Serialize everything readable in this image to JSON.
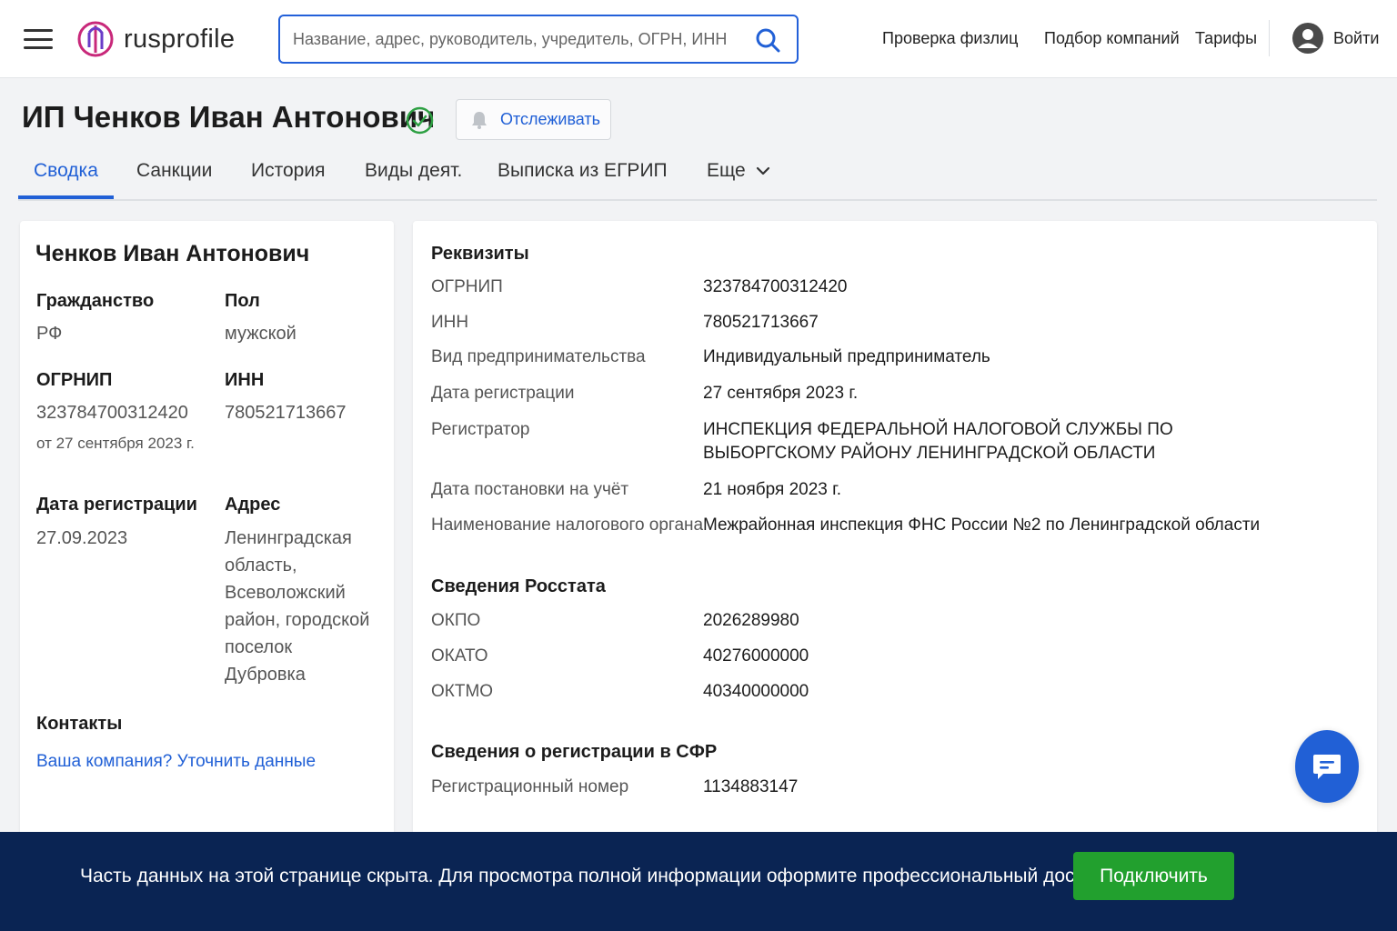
{
  "header": {
    "logo_text": "rusprofile",
    "search_placeholder": "Название, адрес, руководитель, учредитель, ОГРН, ИНН",
    "nav": [
      "Проверка физлиц",
      "Подбор компаний",
      "Тарифы"
    ],
    "login_label": "Войти"
  },
  "title": {
    "name": "ИП Ченков Иван Антонович",
    "track_label": "Отслеживать"
  },
  "tabs": [
    "Сводка",
    "Санкции",
    "История",
    "Виды деят.",
    "Выписка из ЕГРИП",
    "Еще"
  ],
  "left_card": {
    "name": "Ченков Иван Антонович",
    "citizenship_label": "Гражданство",
    "citizenship_value": "РФ",
    "gender_label": "Пол",
    "gender_value": "мужской",
    "ogrnip_label": "ОГРНИП",
    "ogrnip_value": "323784700312420",
    "ogrnip_date": "от 27 сентября 2023 г.",
    "inn_label": "ИНН",
    "inn_value": "780521713667",
    "regdate_label": "Дата регистрации",
    "regdate_value": "27.09.2023",
    "address_label": "Адрес",
    "address_value": "Ленинградская область, Всеволожский район, городской поселок Дубровка",
    "contacts_label": "Контакты",
    "contacts_link": "Ваша компания? Уточнить данные"
  },
  "right_card": {
    "requisites_title": "Реквизиты",
    "requisites": [
      {
        "label": "ОГРНИП",
        "value": "323784700312420"
      },
      {
        "label": "ИНН",
        "value": "780521713667"
      },
      {
        "label": "Вид предпринимательства",
        "value": "Индивидуальный предприниматель"
      },
      {
        "label": "Дата регистрации",
        "value": "27 сентября 2023 г."
      },
      {
        "label": "Регистратор",
        "value": "ИНСПЕКЦИЯ ФЕДЕРАЛЬНОЙ НАЛОГОВОЙ СЛУЖБЫ ПО ВЫБОРГСКОМУ РАЙОНУ ЛЕНИНГРАДСКОЙ ОБЛАСТИ"
      },
      {
        "label": "Дата постановки на учёт",
        "value": "21 ноября 2023 г."
      },
      {
        "label": "Наименование налогового органа",
        "value": "Межрайонная инспекция ФНС России №2 по Ленинградской области"
      }
    ],
    "rosstat_title": "Сведения Росстата",
    "rosstat": [
      {
        "label": "ОКПО",
        "value": "2026289980"
      },
      {
        "label": "ОКАТО",
        "value": "40276000000"
      },
      {
        "label": "ОКТМО",
        "value": "40340000000"
      }
    ],
    "sfr_title": "Сведения о регистрации в СФР",
    "sfr": [
      {
        "label": "Регистрационный номер",
        "value": "1134883147"
      }
    ]
  },
  "banner": {
    "text": "Часть данных на этой странице скрыта. Для просмотра полной информации оформите профессиональный доступ",
    "button_label": "Подключить"
  },
  "colors": {
    "accent": "#2160d6",
    "banner_bg": "#0a2453",
    "connect_green": "#22a02e",
    "verified_green": "#2ea043"
  }
}
